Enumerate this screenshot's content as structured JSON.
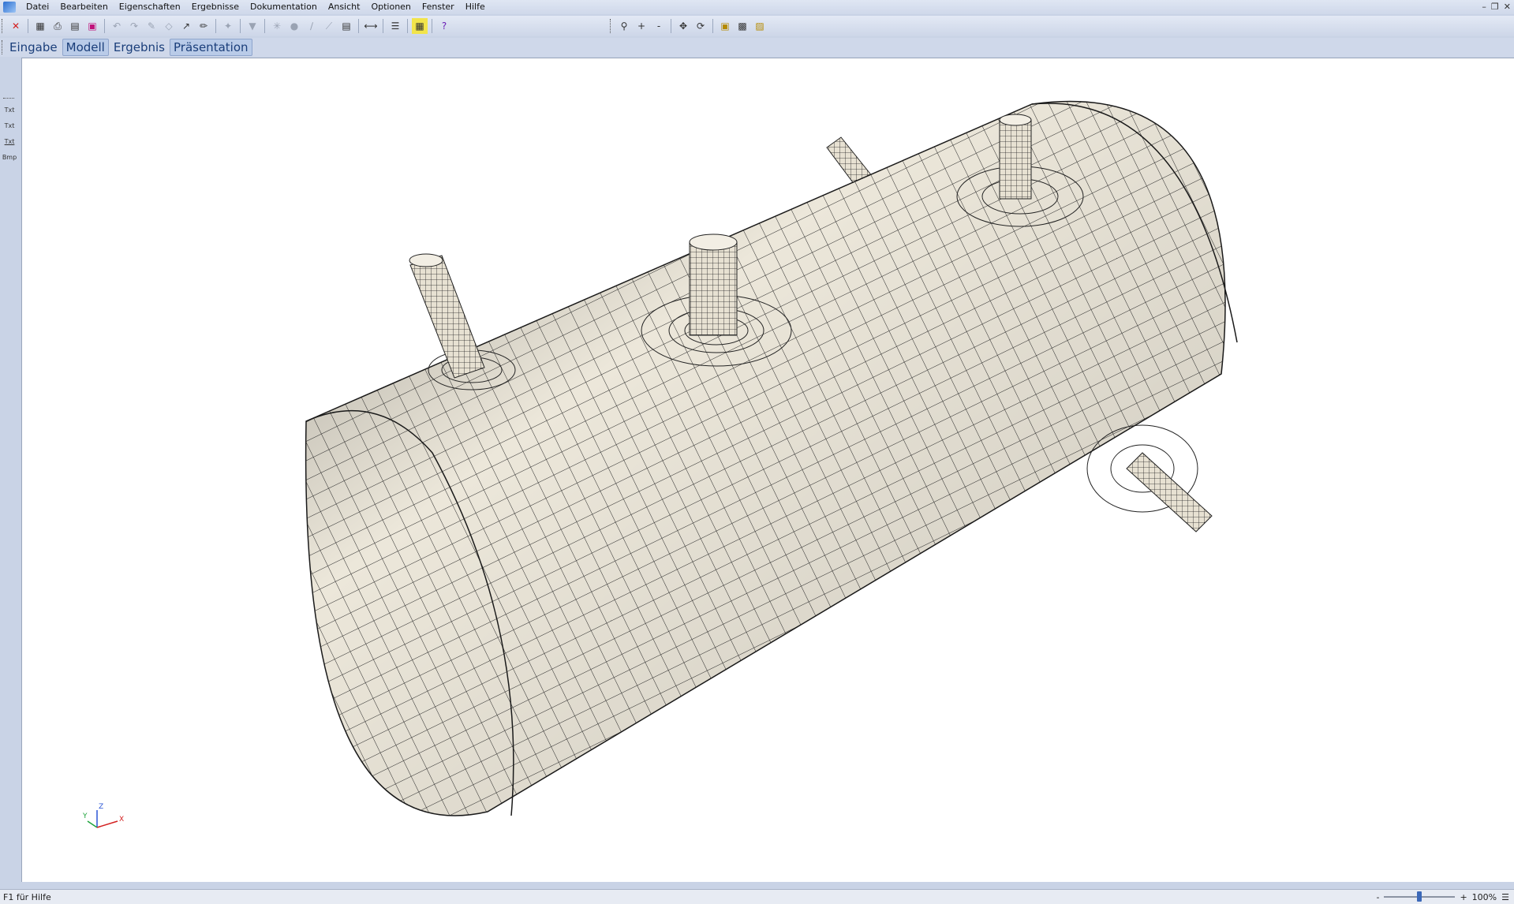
{
  "menu": {
    "items": [
      "Datei",
      "Bearbeiten",
      "Eigenschaften",
      "Ergebnisse",
      "Dokumentation",
      "Ansicht",
      "Optionen",
      "Fenster",
      "Hilfe"
    ]
  },
  "tabs": [
    {
      "label": "Eingabe"
    },
    {
      "label": "Modell"
    },
    {
      "label": "Ergebnis"
    },
    {
      "label": "Präsentation"
    }
  ],
  "palette": {
    "items": [
      "Txt",
      "Txt",
      "Txt",
      "Bmp"
    ]
  },
  "axes": {
    "x": "X",
    "y": "Y",
    "z": "Z"
  },
  "status": {
    "help": "F1 für Hilfe",
    "zoom_minus": "-",
    "zoom_plus": "+",
    "zoom": "100%",
    "zoom_fraction": 0.5
  },
  "colors": {
    "mesh_fill": "#ece7da",
    "mesh_line": "#2a2a2a",
    "accent": "#3b68b8"
  }
}
